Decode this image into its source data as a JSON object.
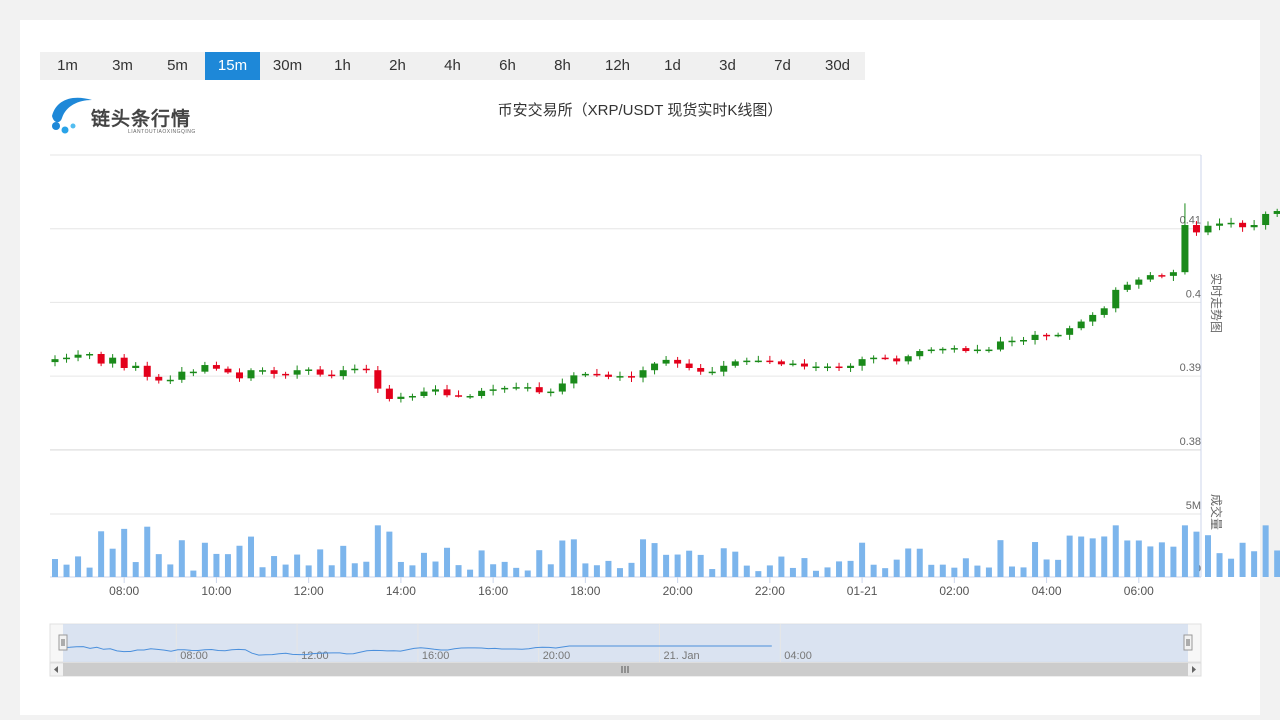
{
  "intervals": [
    {
      "label": "1m",
      "active": false
    },
    {
      "label": "3m",
      "active": false
    },
    {
      "label": "5m",
      "active": false
    },
    {
      "label": "15m",
      "active": true
    },
    {
      "label": "30m",
      "active": false
    },
    {
      "label": "1h",
      "active": false
    },
    {
      "label": "2h",
      "active": false
    },
    {
      "label": "4h",
      "active": false
    },
    {
      "label": "6h",
      "active": false
    },
    {
      "label": "8h",
      "active": false
    },
    {
      "label": "12h",
      "active": false
    },
    {
      "label": "1d",
      "active": false
    },
    {
      "label": "3d",
      "active": false
    },
    {
      "label": "7d",
      "active": false
    },
    {
      "label": "30d",
      "active": false
    }
  ],
  "logo": {
    "name": "链头条行情",
    "sub": "LIANTOUTIAOXINGQING"
  },
  "colors": {
    "up": "#1a8a1a",
    "down": "#e3001b",
    "volume": "#7cb5ec",
    "active_tab": "#1e88d8",
    "navigator_fill": "#d0dcef",
    "navigator_line": "#4a8fdc"
  },
  "chart_data": {
    "type": "candlestick",
    "title": "币安交易所（XRP/USDT 现货实时K线图）",
    "price_axis_title": "实时走势图",
    "volume_axis_title": "成交量",
    "price_ticks": [
      {
        "value": 0.41,
        "label": "0.41"
      },
      {
        "value": 0.4,
        "label": "0.4"
      },
      {
        "value": 0.39,
        "label": "0.39"
      },
      {
        "value": 0.38,
        "label": "0.38"
      }
    ],
    "volume_ticks": [
      {
        "value": 5000000,
        "label": "5M"
      },
      {
        "value": 0,
        "label": "0"
      }
    ],
    "time_ticks": [
      {
        "time": "08:00",
        "label": "08:00"
      },
      {
        "time": "10:00",
        "label": "10:00"
      },
      {
        "time": "12:00",
        "label": "12:00"
      },
      {
        "time": "14:00",
        "label": "14:00"
      },
      {
        "time": "16:00",
        "label": "16:00"
      },
      {
        "time": "18:00",
        "label": "18:00"
      },
      {
        "time": "20:00",
        "label": "20:00"
      },
      {
        "time": "22:00",
        "label": "22:00"
      },
      {
        "time": "00:00",
        "label": "01-21"
      },
      {
        "time": "02:00",
        "label": "02:00"
      },
      {
        "time": "04:00",
        "label": "04:00"
      },
      {
        "time": "06:00",
        "label": "06:00"
      }
    ],
    "interval": "15m",
    "start_time": "01-20 06:30",
    "close": [
      0.3923,
      0.3925,
      0.3929,
      0.393,
      0.3917,
      0.3925,
      0.3911,
      0.3914,
      0.3899,
      0.3894,
      0.3895,
      0.3906,
      0.3906,
      0.3915,
      0.391,
      0.3905,
      0.3897,
      0.3908,
      0.3908,
      0.3903,
      0.3902,
      0.3908,
      0.3909,
      0.3902,
      0.39,
      0.3908,
      0.391,
      0.3908,
      0.3883,
      0.3869,
      0.3872,
      0.3873,
      0.3879,
      0.3882,
      0.3874,
      0.3873,
      0.3873,
      0.388,
      0.3882,
      0.3884,
      0.3885,
      0.3885,
      0.3878,
      0.3879,
      0.389,
      0.3901,
      0.3903,
      0.3902,
      0.3899,
      0.39,
      0.3898,
      0.3908,
      0.3917,
      0.3922,
      0.3917,
      0.3911,
      0.3906,
      0.3906,
      0.3914,
      0.392,
      0.3921,
      0.3921,
      0.392,
      0.3916,
      0.3917,
      0.3913,
      0.3913,
      0.3913,
      0.3911,
      0.3914,
      0.3923,
      0.3925,
      0.3924,
      0.392,
      0.3927,
      0.3934,
      0.3936,
      0.3937,
      0.3938,
      0.3934,
      0.3936,
      0.3936,
      0.3947,
      0.3948,
      0.3949,
      0.3956,
      0.3955,
      0.3956,
      0.3965,
      0.3974,
      0.3983,
      0.3992,
      0.4017,
      0.4024,
      0.4031,
      0.4037,
      0.4036,
      0.4041,
      0.4105,
      0.4095,
      0.4104,
      0.4107,
      0.4108,
      0.4102,
      0.4105,
      0.412,
      0.4124
    ]
  }
}
